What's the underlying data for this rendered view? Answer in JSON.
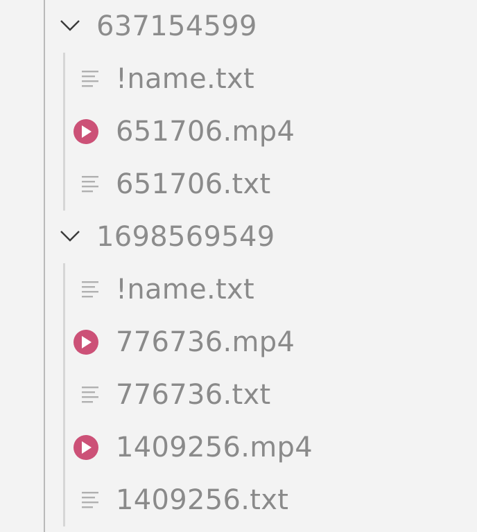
{
  "colors": {
    "background": "#f3f3f3",
    "text": "#8a8a8a",
    "video_icon": "#cc5177",
    "text_icon": "#b0b0b0"
  },
  "tree": [
    {
      "name": "637154599",
      "expanded": true,
      "files": [
        {
          "name": "!name.txt",
          "icon": "text-lines-icon"
        },
        {
          "name": "651706.mp4",
          "icon": "play-video-icon"
        },
        {
          "name": "651706.txt",
          "icon": "text-lines-icon"
        }
      ]
    },
    {
      "name": "1698569549",
      "expanded": true,
      "files": [
        {
          "name": "!name.txt",
          "icon": "text-lines-icon"
        },
        {
          "name": "776736.mp4",
          "icon": "play-video-icon"
        },
        {
          "name": "776736.txt",
          "icon": "text-lines-icon"
        },
        {
          "name": "1409256.mp4",
          "icon": "play-video-icon"
        },
        {
          "name": "1409256.txt",
          "icon": "text-lines-icon"
        }
      ]
    }
  ]
}
